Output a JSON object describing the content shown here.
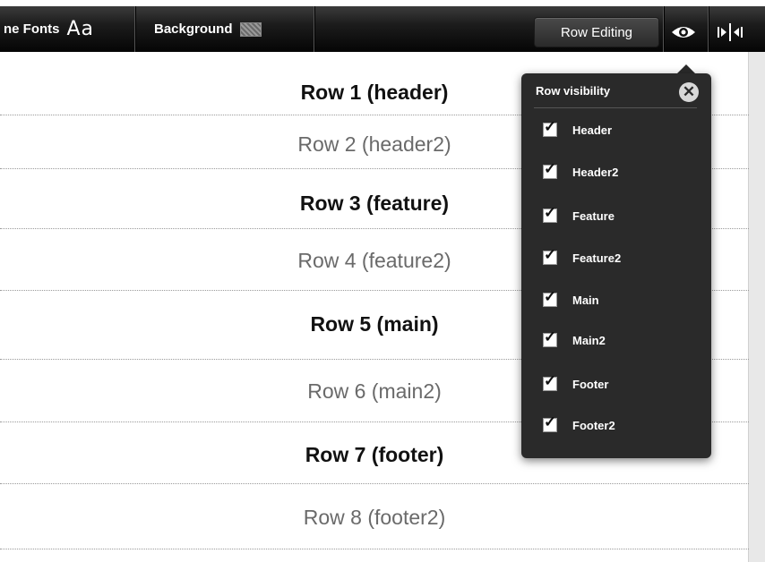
{
  "toolbar": {
    "fonts_label": "ne Fonts",
    "fonts_glyph": "Aa",
    "background_label": "Background",
    "row_editing_label": "Row Editing"
  },
  "rows": [
    {
      "label": "Row 1 (header)",
      "style": "bold"
    },
    {
      "label": "Row 2 (header2)",
      "style": "light"
    },
    {
      "label": "Row 3 (feature)",
      "style": "bold"
    },
    {
      "label": "Row 4 (feature2)",
      "style": "light"
    },
    {
      "label": "Row 5 (main)",
      "style": "bold"
    },
    {
      "label": "Row 6 (main2)",
      "style": "light"
    },
    {
      "label": "Row 7 (footer)",
      "style": "bold"
    },
    {
      "label": "Row 8 (footer2)",
      "style": "light"
    }
  ],
  "visibility_popup": {
    "title": "Row visibility",
    "items": [
      {
        "label": "Header",
        "checked": true
      },
      {
        "label": "Header2",
        "checked": true
      },
      {
        "label": "Feature",
        "checked": true
      },
      {
        "label": "Feature2",
        "checked": true
      },
      {
        "label": "Main",
        "checked": true
      },
      {
        "label": "Main2",
        "checked": true
      },
      {
        "label": "Footer",
        "checked": true
      },
      {
        "label": "Footer2",
        "checked": true
      }
    ]
  },
  "icons": {
    "eye": "eye-icon",
    "split": "split-columns-icon",
    "close": "close-icon",
    "background_swatch": "background-swatch-icon"
  }
}
